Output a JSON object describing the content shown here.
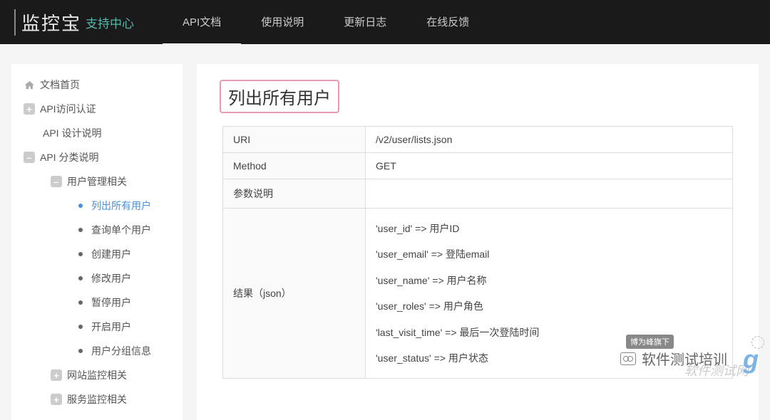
{
  "header": {
    "logo": "监控宝",
    "support": "支持中心",
    "tabs": [
      "API文档",
      "使用说明",
      "更新日志",
      "在线反馈"
    ]
  },
  "sidebar": {
    "home": "文档首页",
    "auth": "API访问认证",
    "design": "API 设计说明",
    "category": "API 分类说明",
    "user_mgmt": "用户管理相关",
    "items": [
      "列出所有用户",
      "查询单个用户",
      "创建用户",
      "修改用户",
      "暂停用户",
      "开启用户",
      "用户分组信息"
    ],
    "site_monitor": "网站监控相关",
    "service_monitor": "服务监控相关"
  },
  "content": {
    "title": "列出所有用户",
    "rows": {
      "uri_label": "URI",
      "uri_value": "/v2/user/lists.json",
      "method_label": "Method",
      "method_value": "GET",
      "params_label": "参数说明",
      "params_value": "",
      "result_label": "结果（json）",
      "result_lines": [
        "'user_id' => 用户ID",
        "'user_email' => 登陆email",
        "'user_name' => 用户名称",
        "'user_roles' => 用户角色",
        "'last_visit_time' => 最后一次登陆时间",
        "'user_status' => 用户状态"
      ]
    }
  },
  "watermark": {
    "badge": "博为峰旗下",
    "main": "软件测试培训",
    "sub": "软件测试网"
  }
}
